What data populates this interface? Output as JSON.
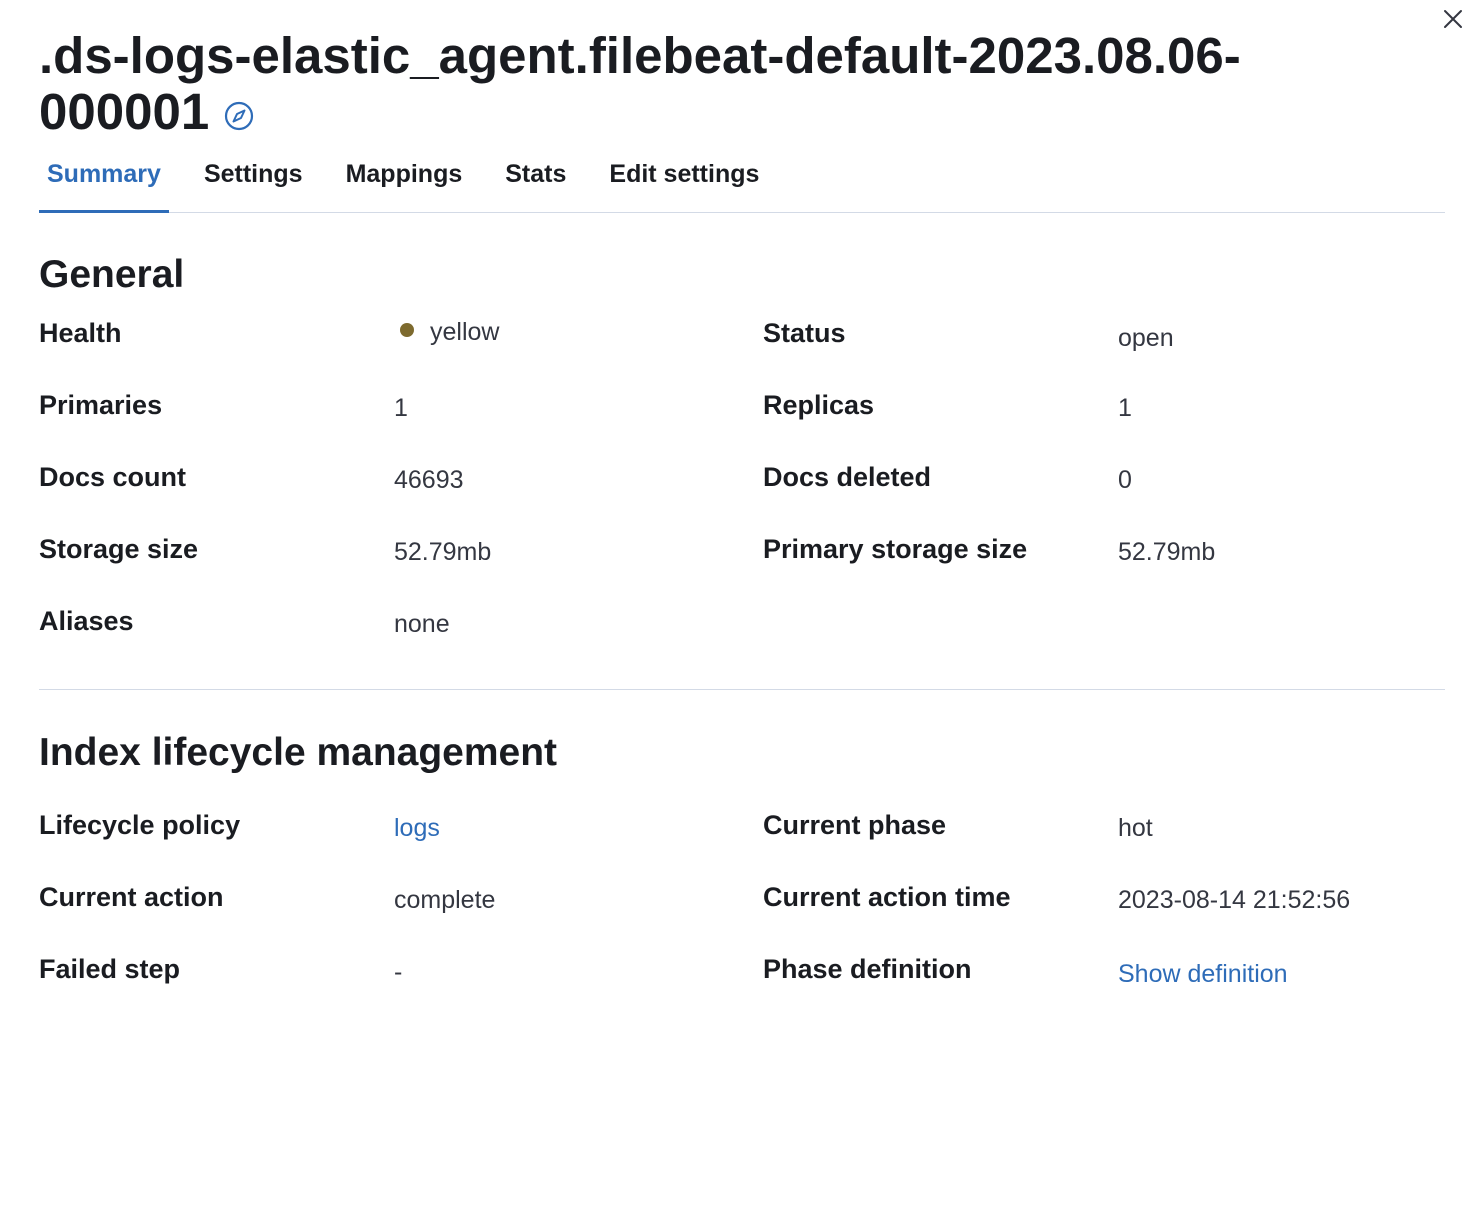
{
  "flyout": {
    "title_line1": ".ds-logs-elastic_agent.filebeat-default-2023.08.06-",
    "title_line2": "000001",
    "close_label": "Close",
    "title_icon": "compass-icon"
  },
  "tabs": [
    {
      "label": "Summary",
      "active": true
    },
    {
      "label": "Settings",
      "active": false
    },
    {
      "label": "Mappings",
      "active": false
    },
    {
      "label": "Stats",
      "active": false
    },
    {
      "label": "Edit settings",
      "active": false
    }
  ],
  "general": {
    "title": "General",
    "health_label": "Health",
    "health_value": "yellow",
    "health_color": "#7d6a2e",
    "status_label": "Status",
    "status_value": "open",
    "primaries_label": "Primaries",
    "primaries_value": "1",
    "replicas_label": "Replicas",
    "replicas_value": "1",
    "docs_count_label": "Docs count",
    "docs_count_value": "46693",
    "docs_deleted_label": "Docs deleted",
    "docs_deleted_value": "0",
    "storage_size_label": "Storage size",
    "storage_size_value": "52.79mb",
    "primary_storage_size_label": "Primary storage size",
    "primary_storage_size_value": "52.79mb",
    "aliases_label": "Aliases",
    "aliases_value": "none"
  },
  "ilm": {
    "title": "Index lifecycle management",
    "lifecycle_policy_label": "Lifecycle policy",
    "lifecycle_policy_value": "logs",
    "current_phase_label": "Current phase",
    "current_phase_value": "hot",
    "current_action_label": "Current action",
    "current_action_value": "complete",
    "current_action_time_label": "Current action time",
    "current_action_time_value": "2023-08-14 21:52:56",
    "failed_step_label": "Failed step",
    "failed_step_value": "-",
    "phase_definition_label": "Phase definition",
    "phase_definition_value": "Show definition"
  },
  "colors": {
    "accent": "#2e6cb8",
    "text": "#1a1c21",
    "border": "#d3dae6"
  }
}
